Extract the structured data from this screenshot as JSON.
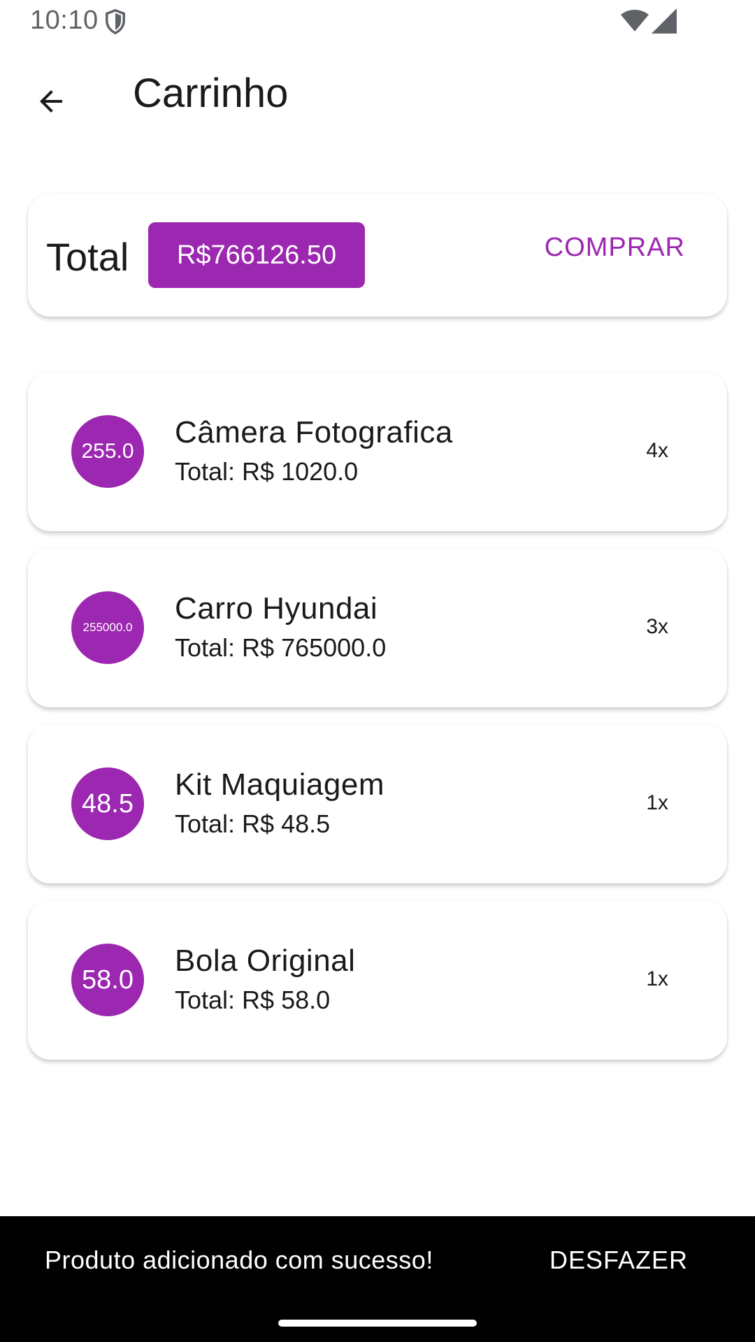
{
  "status_bar": {
    "time": "10:10",
    "icons": [
      "shield-icon",
      "wifi-icon",
      "signal-icon"
    ]
  },
  "app_bar": {
    "back_icon": "arrow-back-icon",
    "title": "Carrinho"
  },
  "summary": {
    "total_label": "Total",
    "total_value": "R$766126.50",
    "buy_label": "COMPRAR"
  },
  "items": [
    {
      "price": "255.0",
      "name": "Câmera Fotografica",
      "total": "Total: R$ 1020.0",
      "qty": "4x"
    },
    {
      "price": "255000.0",
      "name": "Carro Hyundai",
      "total": "Total: R$ 765000.0",
      "qty": "3x"
    },
    {
      "price": "48.5",
      "name": "Kit Maquiagem",
      "total": "Total: R$ 48.5",
      "qty": "1x"
    },
    {
      "price": "58.0",
      "name": "Bola Original",
      "total": "Total: R$ 58.0",
      "qty": "1x"
    }
  ],
  "snackbar": {
    "message": "Produto adicionado com sucesso!",
    "action": "DESFAZER"
  },
  "colors": {
    "accent": "#9c27b0",
    "snackbar_bg": "#000000",
    "status_icon": "#5f6368"
  }
}
